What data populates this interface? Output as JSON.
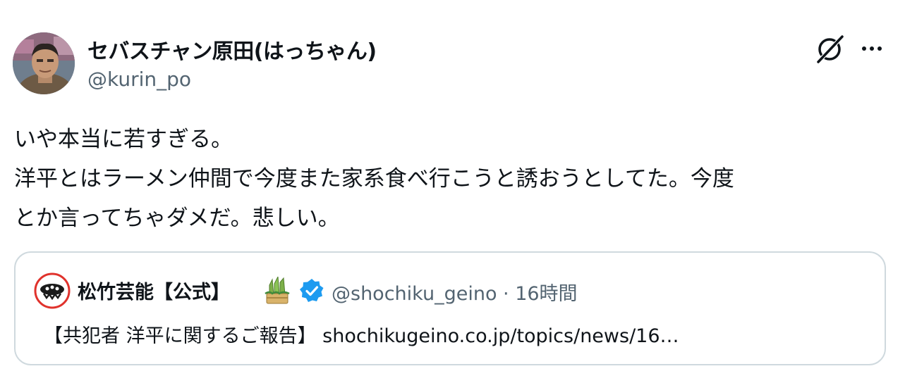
{
  "tweet": {
    "author_name": "セバスチャン原田(はっちゃん)",
    "author_handle": "@kurin_po",
    "lines": [
      "いや本当に若すぎる。",
      "洋平とはラーメン仲間で今度また家系食べ行こうと誘おうとしてた。今度",
      "とか言ってちゃダメだ。悲しい。"
    ],
    "icons": {
      "grok": "grok-icon",
      "more": "more-icon",
      "avatar": "avatar"
    }
  },
  "quote": {
    "author_name": "松竹芸能【公式】",
    "author_handle": "@shochiku_geino · 16時間",
    "text": "【共犯者 洋平に関するご報告】  shochikugeino.co.jp/topics/news/16…",
    "icons": {
      "avatar": "shochiku-logo",
      "emoji": "kadomatsu-icon",
      "verified": "verified-badge-icon"
    }
  },
  "colors": {
    "text_primary": "#0f1419",
    "text_secondary": "#536471",
    "border": "#cfd9de",
    "verified_blue": "#1d9bf0",
    "logo_red": "#e0322c"
  }
}
